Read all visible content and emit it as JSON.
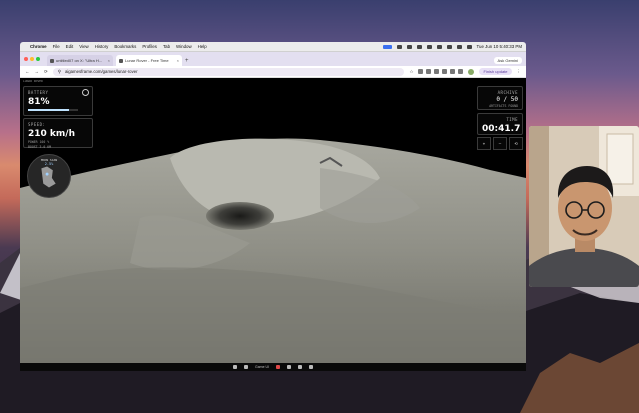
{
  "menubar": {
    "app": "Chrome",
    "items": [
      "File",
      "Edit",
      "View",
      "History",
      "Bookmarks",
      "Profiles",
      "Tab",
      "Window",
      "Help"
    ],
    "clock": "Tue Jun 10  5:40:33 PM"
  },
  "tabs": [
    {
      "title": "untitled07 on X: \"Ultra H...",
      "active": false
    },
    {
      "title": "Lunar Rover - Free Time",
      "active": true
    }
  ],
  "tabbar_right": "Ask Gemini",
  "address": {
    "url": "aigamesframe.com/games/lunar-rover",
    "finish_update": "Finish update"
  },
  "hud": {
    "top_left": "LUNAR ROVER",
    "battery_label": "BATTERY",
    "battery_value": "81%",
    "battery_fraction": 0.81,
    "speed_label": "SPEED:",
    "speed_value": "210 km/h",
    "speed_sub1": "POWER 100 %",
    "speed_sub2": "BOOST 3.0 KM",
    "minimap_label": "MOON SCAN",
    "minimap_pct": "2.5%",
    "archive_label": "ARCHIVE",
    "archive_value": "0 / 50",
    "archive_sub": "ARTIFACTS FOUND",
    "time_label": "TIME",
    "time_value": "00:41.7",
    "controls": [
      "+",
      "–",
      "⟲"
    ]
  },
  "dock": {
    "center_label": "Game UI"
  },
  "colors": {
    "menubar_bg": "#ececec",
    "tab_active": "#ffffff",
    "hud_text": "#ffffff",
    "battery_fill": "#bfe3ff"
  }
}
